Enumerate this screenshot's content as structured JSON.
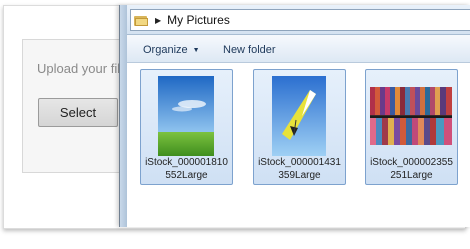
{
  "upload": {
    "prompt": "Upload your file",
    "select_label": "Select"
  },
  "dialog": {
    "address": {
      "folder": "My Pictures"
    },
    "toolbar": {
      "organize_label": "Organize",
      "new_folder_label": "New folder"
    },
    "files": [
      {
        "name_line1": "iStock_000001810",
        "name_line2": "552Large",
        "thumbnail": "sky-grass-photo"
      },
      {
        "name_line1": "iStock_000001431",
        "name_line2": "359Large",
        "thumbnail": "hang-glider-photo"
      },
      {
        "name_line1": "iStock_000002355",
        "name_line2": "251Large",
        "thumbnail": "fabric-rolls-photo"
      }
    ]
  },
  "colors": {
    "selection_border": "#7da2ce",
    "selection_fill": "#cfe0f4"
  }
}
